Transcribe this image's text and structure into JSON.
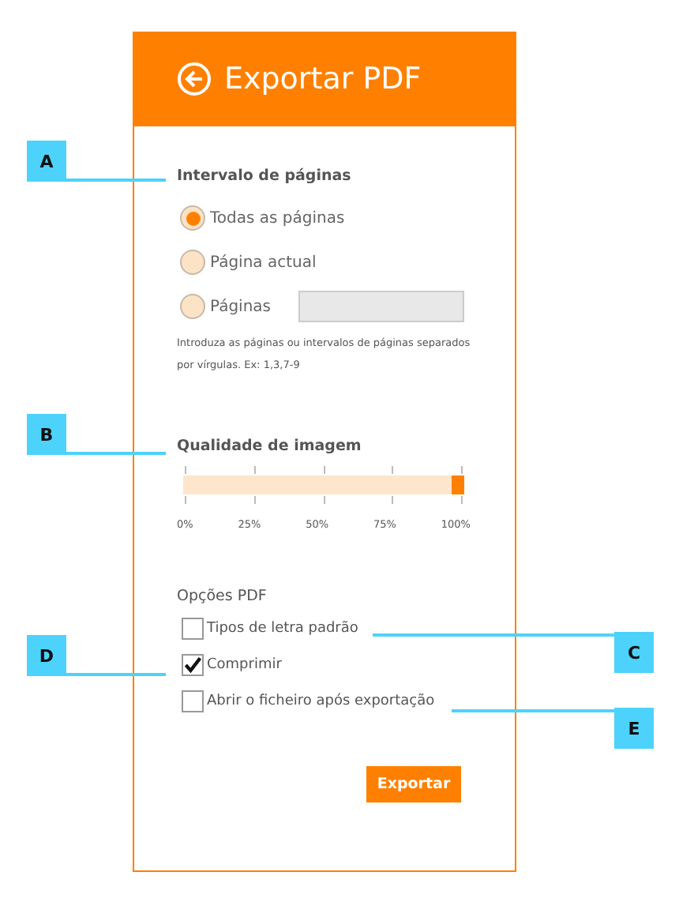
{
  "header": {
    "title": "Exportar PDF"
  },
  "page_range": {
    "heading": "Intervalo de páginas",
    "options": [
      {
        "label": "Todas as páginas",
        "selected": true,
        "kind": "plain"
      },
      {
        "label": "Página actual",
        "selected": false,
        "kind": "plain"
      },
      {
        "label": "Páginas",
        "selected": false,
        "kind": "field"
      }
    ],
    "hint": "Introduza as páginas ou intervalos de páginas separados por vírgulas. Ex: 1,3,7-9"
  },
  "quality": {
    "heading": "Qualidade de imagem",
    "level": 1,
    "ticks": [
      "0%",
      "25%",
      "50%",
      "75%",
      "100%"
    ]
  },
  "options": {
    "heading": "Opções PDF",
    "items": [
      {
        "label": "Tipos de letra padrão",
        "checked": false
      },
      {
        "label": "Comprimir",
        "checked": true
      },
      {
        "label": "Abrir o ficheiro após exportação",
        "checked": false
      }
    ]
  },
  "export_button": "Exportar",
  "callouts": [
    {
      "label": "A"
    },
    {
      "label": "B"
    },
    {
      "label": "D"
    },
    {
      "label": "C"
    },
    {
      "label": "E"
    }
  ]
}
